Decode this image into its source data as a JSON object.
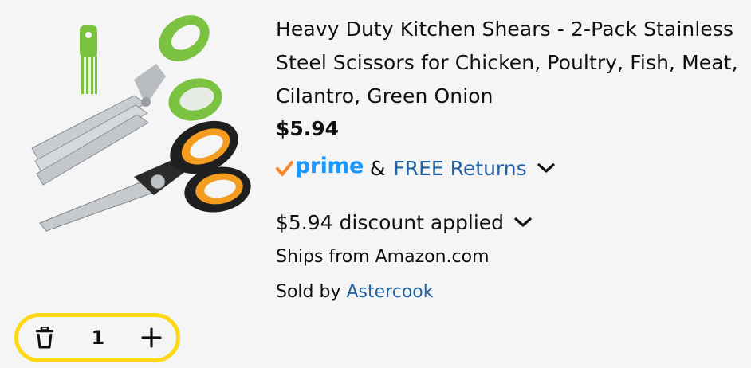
{
  "product": {
    "image_alt": "kitchen-shears-product-image",
    "title": "Heavy Duty Kitchen Shears - 2-Pack Stainless Steel Scissors for Chicken, Poultry, Fish, Meat, Cilantro, Green Onion",
    "price": "$5.94",
    "prime": {
      "logo_text": "prime",
      "amp": "&",
      "returns_label": "FREE Returns"
    },
    "discount_text": "$5.94 discount applied",
    "ships_from": "Ships from Amazon.com",
    "sold_by_prefix": "Sold by ",
    "seller_name": "Astercook"
  },
  "stepper": {
    "quantity": "1"
  },
  "colors": {
    "prime_blue": "#1a98ff",
    "prime_check": "#f7842a",
    "link_blue": "#2162a1",
    "stepper_border": "#ffd814",
    "text": "#0f1111"
  },
  "icons": {
    "delete": "trash-icon",
    "add": "plus-icon",
    "expand": "chevron-down-icon",
    "prime_check": "prime-check-icon"
  }
}
